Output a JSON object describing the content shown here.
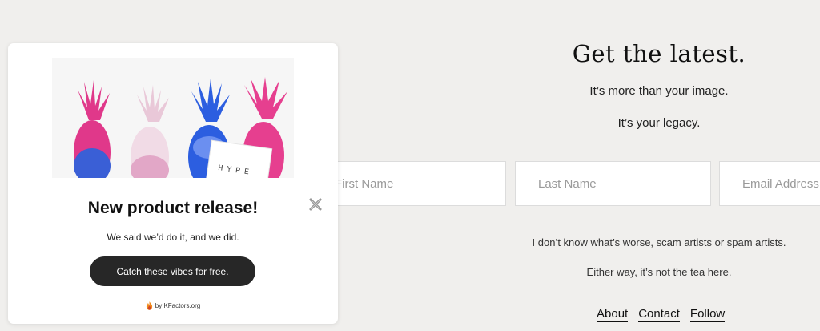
{
  "newsletter": {
    "title": "Get the latest.",
    "line1": "It’s more than your image.",
    "line2": "It’s your legacy.",
    "fields": {
      "first_placeholder": "First Name",
      "last_placeholder": "Last Name",
      "email_placeholder": "Email Address"
    },
    "note1": "I don’t know what’s worse, scam artists or spam artists.",
    "note2": "Either way, it’s not the tea here.",
    "links": [
      "About",
      "Contact",
      "Follow"
    ]
  },
  "popup": {
    "hero_card_text": "HYPE",
    "title": "New product release!",
    "subtitle": "We said we’d do it, and we did.",
    "cta": "Catch these vibes for free.",
    "credit": "by KFactors.org"
  },
  "colors": {
    "page_bg": "#f0efed",
    "pink": "#e83f8e",
    "blue": "#2c5ee0",
    "button_bg": "#272727"
  },
  "icons": {
    "close": "close-icon",
    "flame": "flame-icon"
  }
}
